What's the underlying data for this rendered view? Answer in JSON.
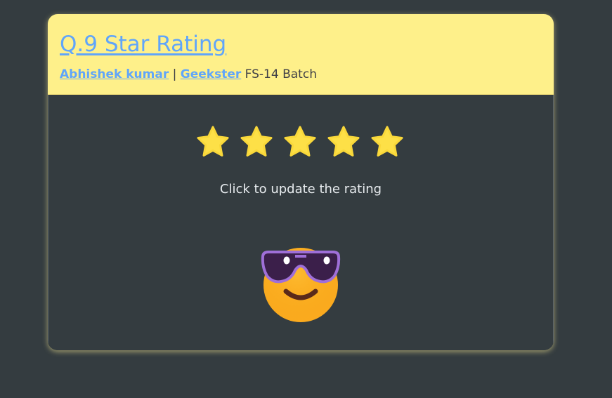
{
  "header": {
    "title": "Q.9 Star Rating",
    "author": "Abhishek kumar",
    "separator": "|",
    "org": "Geekster",
    "batch": "FS-14 Batch"
  },
  "rating": {
    "stars": [
      {
        "label": "1 star",
        "filled": true
      },
      {
        "label": "2 stars",
        "filled": true
      },
      {
        "label": "3 stars",
        "filled": true
      },
      {
        "label": "4 stars",
        "filled": true
      },
      {
        "label": "5 stars",
        "filled": true
      }
    ],
    "value": 5,
    "max": 5,
    "hint": "Click to update the rating",
    "emoji": "sunglasses-smile-icon"
  },
  "colors": {
    "background": "#343c40",
    "header_bg": "#fef08a",
    "link": "#60a5fa",
    "star": "#fde047",
    "emoji_face": "#fbbf24"
  }
}
